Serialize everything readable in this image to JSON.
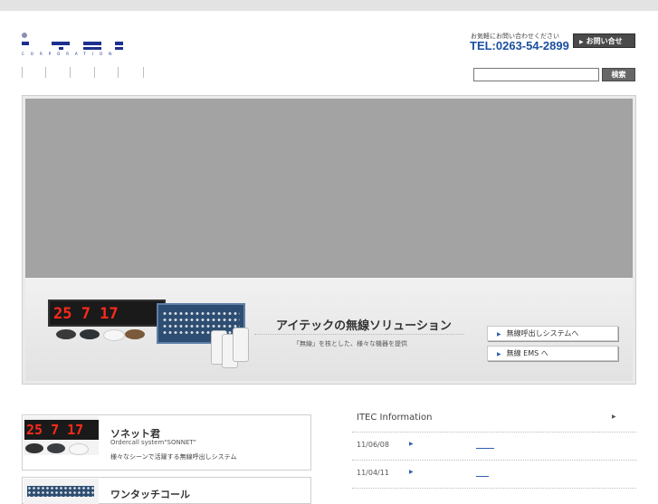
{
  "logo": {
    "alt": "ITEC",
    "subtext": "CORPORATION"
  },
  "contact": {
    "note": "お気軽にお問い合わせください",
    "tel": "TEL:0263-54-2899",
    "button_label": "お問い合せ"
  },
  "search": {
    "value": "",
    "button_label": "検索"
  },
  "hero": {
    "title": "アイテックの無線ソリューション",
    "subtitle": "「無線」を核とした、様々な機器を提供",
    "display_digits": "25  7 17",
    "buttons": [
      {
        "label": "無線呼出しシステムへ"
      },
      {
        "label": "無線 EMS へ"
      }
    ]
  },
  "products": [
    {
      "title": "ソネット君",
      "subtitle_en": "Ordercall system\"SONNET\"",
      "description": "様々なシーンで活躍する無線呼出しシステム",
      "display_digits": "25  7 17"
    },
    {
      "title": "ワンタッチコール"
    }
  ],
  "info": {
    "title": "ITEC Information",
    "items": [
      {
        "date": "11/06/08"
      },
      {
        "date": "11/04/11"
      }
    ]
  },
  "colors": {
    "brand_blue": "#1d2f8f",
    "tel_blue": "#1b4fa0",
    "digit_red": "#ff2a1a",
    "hero_gray": "#a3a3a3"
  },
  "icons": {
    "arrow": "triangle-right-icon"
  }
}
